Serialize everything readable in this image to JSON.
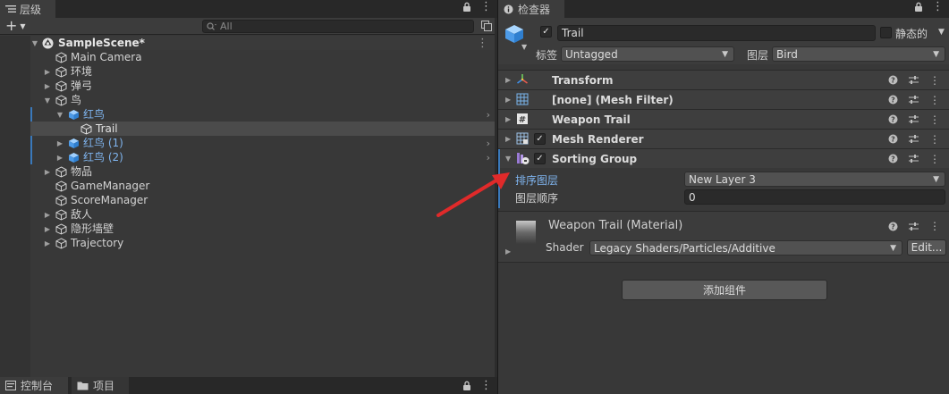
{
  "hierarchy": {
    "tab_label": "层级",
    "search_placeholder": "All",
    "scene_name": "SampleScene*",
    "items": [
      {
        "label": "Main Camera"
      },
      {
        "label": "环境"
      },
      {
        "label": "弹弓"
      },
      {
        "label": "鸟"
      },
      {
        "label": "红鸟"
      },
      {
        "label": "Trail"
      },
      {
        "label": "红鸟 (1)"
      },
      {
        "label": "红鸟 (2)"
      },
      {
        "label": "物品"
      },
      {
        "label": "GameManager"
      },
      {
        "label": "ScoreManager"
      },
      {
        "label": "敌人"
      },
      {
        "label": "隐形墙壁"
      },
      {
        "label": "Trajectory"
      }
    ]
  },
  "bottom_tabs": {
    "console": "控制台",
    "project": "项目"
  },
  "inspector": {
    "tab_label": "检查器",
    "object_name": "Trail",
    "static_label": "静态的",
    "tag_label": "标签",
    "tag_value": "Untagged",
    "layer_label": "图层",
    "layer_value": "Bird",
    "components": [
      {
        "name": "Transform"
      },
      {
        "name": "[none] (Mesh Filter)"
      },
      {
        "name": "Weapon Trail"
      },
      {
        "name": "Mesh Renderer"
      },
      {
        "name": "Sorting Group"
      }
    ],
    "sorting_layer_label": "排序图层",
    "sorting_layer_value": "New Layer 3",
    "order_label": "图层顺序",
    "order_value": "0",
    "material_name": "Weapon Trail (Material)",
    "shader_label": "Shader",
    "shader_value": "Legacy Shaders/Particles/Additive",
    "edit_label": "Edit...",
    "add_component_label": "添加组件"
  },
  "colors": {
    "accent_blue": "#7fb4ee",
    "annotation_red": "#e02a2a"
  }
}
